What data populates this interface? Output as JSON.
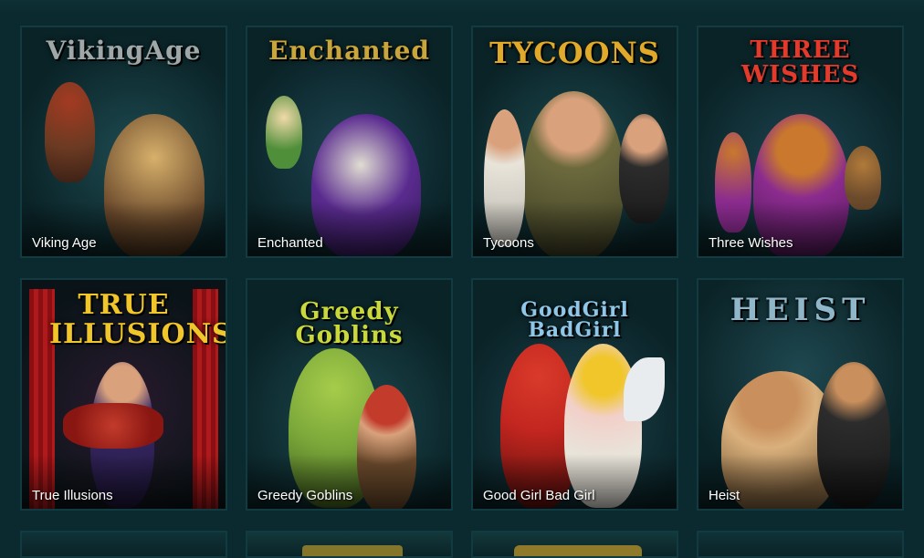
{
  "games": [
    {
      "title": "Viking Age",
      "logo": "VikingAge",
      "logo_color": "#9fa7a8",
      "palette": [
        "#6b4a2c",
        "#d7b06b",
        "#a33a22"
      ]
    },
    {
      "title": "Enchanted",
      "logo": "Enchanted",
      "logo_color": "#c9a63c",
      "palette": [
        "#5a2b8f",
        "#e0ddd2",
        "#4f8f3a"
      ]
    },
    {
      "title": "Tycoons",
      "logo": "TYCOONS",
      "logo_color": "#e1a92a",
      "palette": [
        "#6c6a3d",
        "#d9a17c",
        "#2c2c2c"
      ]
    },
    {
      "title": "Three Wishes",
      "logo": "THREE WISHES",
      "logo_color": "#e43a2c",
      "palette": [
        "#8b2b8f",
        "#e8b03a",
        "#c9782d"
      ]
    },
    {
      "title": "True Illusions",
      "logo": "TRUE ILLUSIONS",
      "logo_color": "#f0c62a",
      "palette": [
        "#b01a1c",
        "#3a2a6a",
        "#c23b2b"
      ]
    },
    {
      "title": "Greedy Goblins",
      "logo": "Greedy Goblins",
      "logo_color": "#c9d83a",
      "palette": [
        "#7ba83a",
        "#c23b2b",
        "#6b4a2c"
      ]
    },
    {
      "title": "Good Girl Bad Girl",
      "logo": "GoodGirl BadGirl",
      "logo_color": "#8fc7e8",
      "palette": [
        "#c2261f",
        "#f2d0c9",
        "#f0c62a"
      ]
    },
    {
      "title": "Heist",
      "logo": "HEIST",
      "logo_color": "#8fb7c9",
      "palette": [
        "#d9b07c",
        "#2c2c2c",
        "#5e7f86"
      ]
    }
  ]
}
